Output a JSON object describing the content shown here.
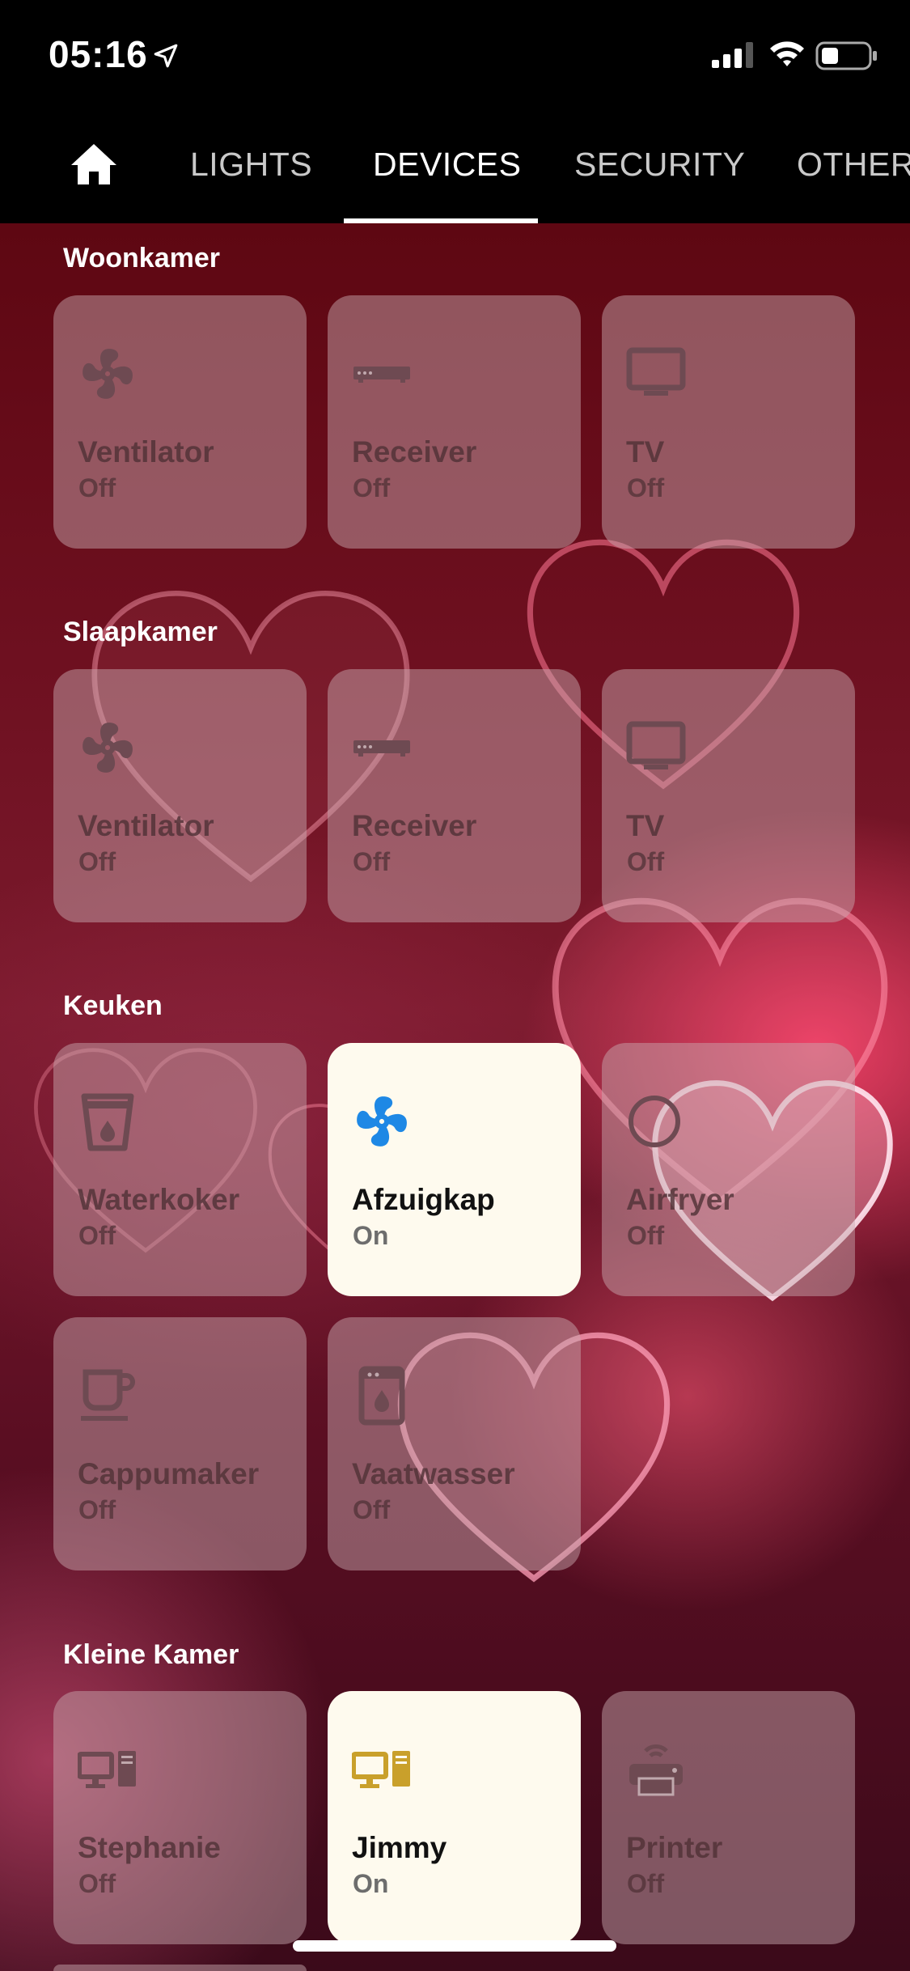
{
  "status_bar": {
    "time": "05:16"
  },
  "tabs": {
    "items": [
      {
        "label": "LIGHTS"
      },
      {
        "label": "DEVICES"
      },
      {
        "label": "SECURITY"
      },
      {
        "label": "OTHER"
      }
    ],
    "active": "DEVICES"
  },
  "sections": [
    {
      "title": "Woonkamer",
      "devices": [
        {
          "name": "Ventilator",
          "state": "Off",
          "icon": "fan-icon"
        },
        {
          "name": "Receiver",
          "state": "Off",
          "icon": "receiver-icon"
        },
        {
          "name": "TV",
          "state": "Off",
          "icon": "tv-icon"
        }
      ]
    },
    {
      "title": "Slaapkamer",
      "devices": [
        {
          "name": "Ventilator",
          "state": "Off",
          "icon": "fan-icon"
        },
        {
          "name": "Receiver",
          "state": "Off",
          "icon": "receiver-icon"
        },
        {
          "name": "TV",
          "state": "Off",
          "icon": "tv-icon"
        }
      ]
    },
    {
      "title": "Keuken",
      "devices": [
        {
          "name": "Waterkoker",
          "state": "Off",
          "icon": "kettle-icon"
        },
        {
          "name": "Afzuigkap",
          "state": "On",
          "icon": "fan-icon"
        },
        {
          "name": "Airfryer",
          "state": "Off",
          "icon": "circle-icon"
        },
        {
          "name": "Cappumaker",
          "state": "Off",
          "icon": "coffee-cup-icon"
        },
        {
          "name": "Vaatwasser",
          "state": "Off",
          "icon": "dishwasher-icon"
        }
      ]
    },
    {
      "title": "Kleine Kamer",
      "devices": [
        {
          "name": "Stephanie",
          "state": "Off",
          "icon": "desktop-computer-icon"
        },
        {
          "name": "Jimmy",
          "state": "On",
          "icon": "desktop-computer-icon"
        },
        {
          "name": "Printer",
          "state": "Off",
          "icon": "printer-icon"
        }
      ]
    }
  ],
  "colors": {
    "tile_on_background": "#fefaee",
    "fan_on_icon": "#1e88e5",
    "computer_on_icon": "#c9a02b",
    "off_icon": "#6e4a52"
  }
}
